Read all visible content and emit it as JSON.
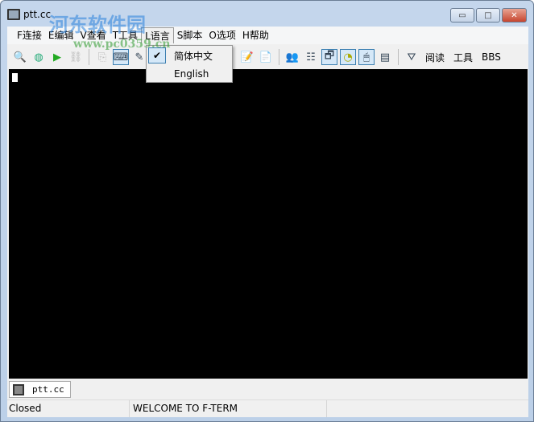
{
  "window": {
    "title": "ptt.cc",
    "minimize": "▭",
    "maximize": "□",
    "close": "✕"
  },
  "watermark": {
    "text": "河东软件园",
    "url": "www.pc0359.cn"
  },
  "menu": [
    "F连接",
    "E编辑",
    "V查看",
    "T工具",
    "L语言",
    "S脚本",
    "O选项",
    "H帮助"
  ],
  "toolbar": {
    "text_buttons": [
      "阅读",
      "工具",
      "BBS"
    ]
  },
  "language_menu": {
    "items": [
      {
        "label": "简体中文",
        "checked": true
      },
      {
        "label": "English",
        "checked": false
      }
    ]
  },
  "tabs": [
    {
      "label": "ptt.cc"
    }
  ],
  "status": {
    "connection": "Closed",
    "message": "WELCOME TO F-TERM",
    "extra": ""
  }
}
